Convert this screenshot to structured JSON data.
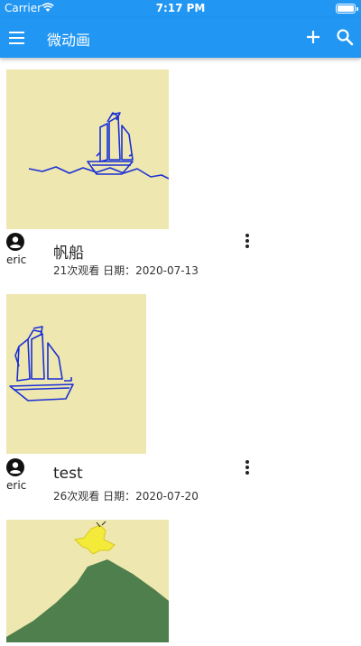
{
  "status_bar": {
    "carrier": "Carrier",
    "time": "7:17 PM"
  },
  "app_bar": {
    "title": "微动画"
  },
  "feed": [
    {
      "title": "帆船",
      "author": "eric",
      "meta": "21次观看  日期：2020-07-13"
    },
    {
      "title": "test",
      "author": "eric",
      "meta": "26次观看  日期：2020-07-20"
    }
  ],
  "colors": {
    "primary": "#2196f3",
    "thumbnail_bg": "#efe7b0",
    "sketch_blue": "#1a2fd6",
    "hill_green": "#4f7f4d",
    "bird_yellow": "#f3ea3a"
  }
}
